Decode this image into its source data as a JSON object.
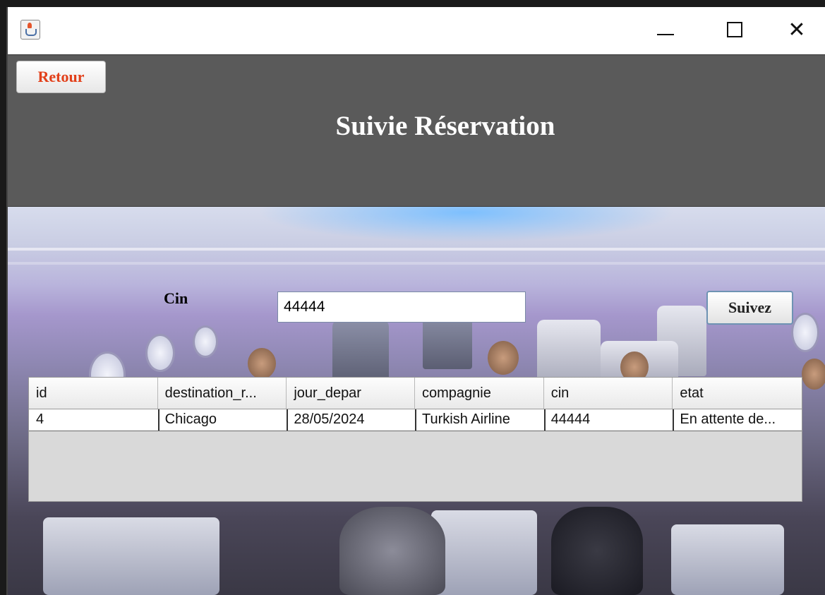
{
  "header": {
    "back_label": "Retour",
    "title": "Suivie Réservation"
  },
  "form": {
    "cin_label": "Cin",
    "cin_value": "44444",
    "submit_label": "Suivez"
  },
  "table": {
    "columns": [
      "id",
      "destination_r...",
      "jour_depar",
      "compagnie",
      "cin",
      "etat"
    ],
    "rows": [
      [
        "4",
        "Chicago",
        "28/05/2024",
        "Turkish Airline",
        "44444",
        "En attente de..."
      ]
    ]
  },
  "icons": {
    "app": "java-app-icon",
    "minimize": "minimize-icon",
    "maximize": "maximize-icon",
    "close": "close-icon"
  },
  "colors": {
    "header_bg": "#5a5a5a",
    "back_text": "#e2401a"
  }
}
